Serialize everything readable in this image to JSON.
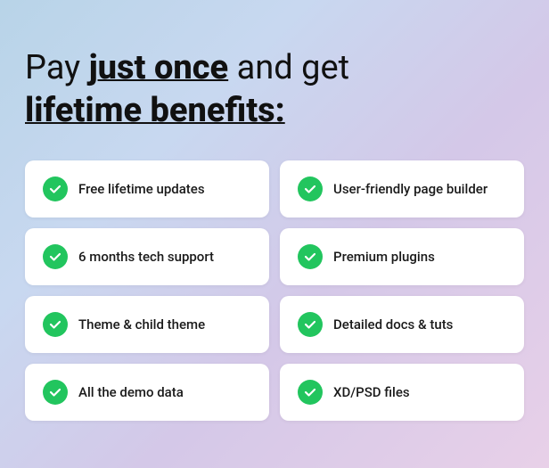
{
  "headline": {
    "part1": "Pay ",
    "bold1": "just once",
    "part2": " and get",
    "line2": "lifetime benefits:"
  },
  "benefits": [
    {
      "id": "free-updates",
      "label": "Free lifetime updates"
    },
    {
      "id": "user-friendly-builder",
      "label": "User-friendly page builder"
    },
    {
      "id": "tech-support",
      "label": "6 months tech support"
    },
    {
      "id": "premium-plugins",
      "label": "Premium plugins"
    },
    {
      "id": "child-theme",
      "label": "Theme & child theme"
    },
    {
      "id": "detailed-docs",
      "label": "Detailed docs & tuts"
    },
    {
      "id": "demo-data",
      "label": "All the demo data"
    },
    {
      "id": "xd-psd",
      "label": "XD/PSD files"
    }
  ]
}
